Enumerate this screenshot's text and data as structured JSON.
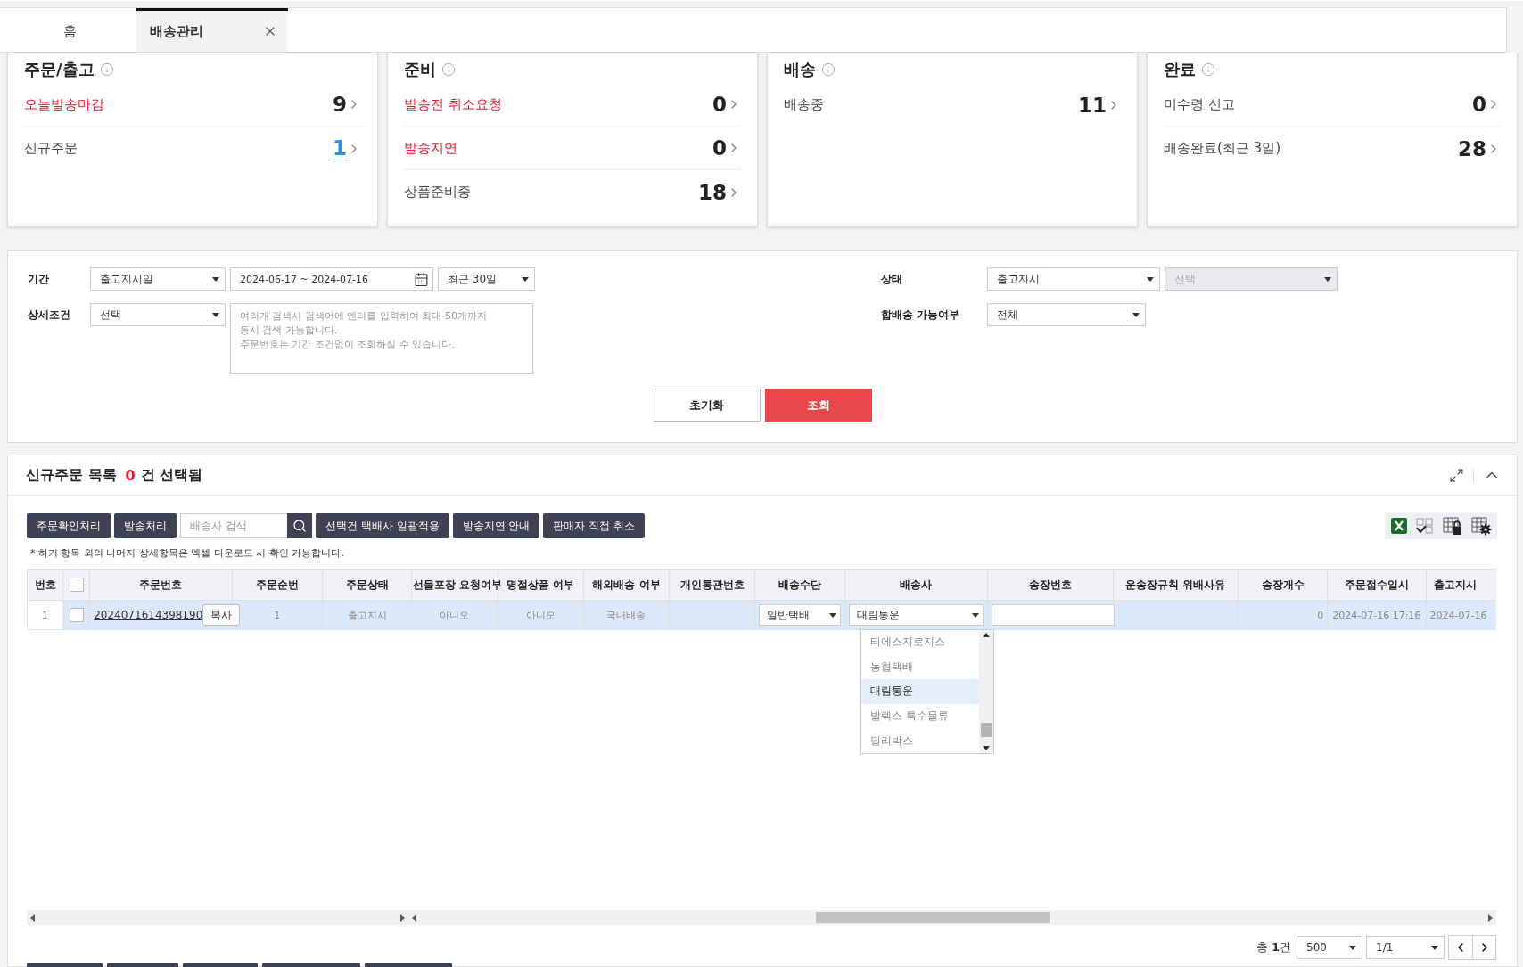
{
  "tabs": [
    {
      "label": "홈",
      "selected": false,
      "closable": false
    },
    {
      "label": "배송관리",
      "selected": true,
      "closable": true
    }
  ],
  "summary": [
    {
      "title": "주문/출고",
      "rows": [
        {
          "label": "오늘발송마감",
          "count": "9",
          "alert": true,
          "highlight": false
        },
        {
          "label": "신규주문",
          "count": "1",
          "alert": false,
          "highlight": true
        }
      ]
    },
    {
      "title": "준비",
      "rows": [
        {
          "label": "발송전 취소요청",
          "count": "0",
          "alert": true,
          "highlight": false
        },
        {
          "label": "발송지연",
          "count": "0",
          "alert": true,
          "highlight": false
        },
        {
          "label": "상품준비중",
          "count": "18",
          "alert": false,
          "highlight": false
        }
      ]
    },
    {
      "title": "배송",
      "rows": [
        {
          "label": "배송중",
          "count": "11",
          "alert": false,
          "highlight": false
        }
      ]
    },
    {
      "title": "완료",
      "rows": [
        {
          "label": "미수령 신고",
          "count": "0",
          "alert": false,
          "highlight": false
        },
        {
          "label": "배송완료(최근 3일)",
          "count": "28",
          "alert": false,
          "highlight": false
        }
      ]
    }
  ],
  "filters": {
    "left": [
      {
        "label": "기간",
        "controls": [
          {
            "kind": "select",
            "value": "출고지시일",
            "disabled": false
          },
          {
            "kind": "date",
            "value": "2024-06-17 ~ 2024-07-16"
          },
          {
            "kind": "select",
            "value": "최근 30일",
            "disabled": false
          }
        ]
      },
      {
        "label": "상세조건",
        "controls": [
          {
            "kind": "select",
            "value": "선택",
            "disabled": false
          },
          {
            "kind": "textarea",
            "placeholder": "여러개 검색시 검색어에 엔터를 입력하여 최대 50개까지\n동시 검색 가능합니다.\n주문번호는 기간 조건없이 조회하실 수 있습니다."
          }
        ]
      }
    ],
    "right": [
      {
        "label": "상태",
        "controls": [
          {
            "kind": "select",
            "value": "출고지시",
            "disabled": false
          },
          {
            "kind": "select",
            "value": "선택",
            "disabled": true
          }
        ]
      },
      {
        "label": "합배송 가능여부",
        "controls": [
          {
            "kind": "select",
            "value": "전체",
            "disabled": false
          }
        ]
      }
    ]
  },
  "filter_buttons": [
    {
      "label": "초기화",
      "kind": "secondary"
    },
    {
      "label": "조회",
      "kind": "primary"
    }
  ],
  "list": {
    "title": "신규주문 목록",
    "selected_count": "0",
    "selected_suffix": "건 선택됨",
    "actions": [
      {
        "kind": "button",
        "label": "주문확인처리"
      },
      {
        "kind": "button",
        "label": "발송처리"
      },
      {
        "kind": "search",
        "placeholder": "배송사 검색"
      },
      {
        "kind": "button",
        "label": "선택건 택배사 일괄적용"
      },
      {
        "kind": "button",
        "label": "발송지연 안내"
      },
      {
        "kind": "button",
        "label": "판매자 직접 취소"
      }
    ],
    "note": "* 하기 항목 외의 나머지 상세항목은 엑셀 다운로드 시 확인 가능합니다.",
    "columns": [
      "번호",
      "",
      "주문번호",
      "주문순번",
      "주문상태",
      "선물포장 요청여부",
      "명절상품 여부",
      "해외배송 여부",
      "개인통관번호",
      "배송수단",
      "배송사",
      "송장번호",
      "운송장규칙 위배사유",
      "송장개수",
      "주문접수일시",
      "출고지시"
    ],
    "header_checked": false,
    "rows": [
      {
        "no": "1",
        "checked": false,
        "selected": true,
        "order_no": "2024071614398190",
        "copy": "복사",
        "seq": "1",
        "status": "출고지시",
        "gift": "아니오",
        "holiday": "아니오",
        "overseas": "국내배송",
        "method": "일반택배",
        "carrier": "대림통운",
        "invoice_count": "0",
        "received": "2024-07-16 17:16",
        "shipped": "2024-07-16"
      }
    ],
    "carrier_options": [
      {
        "label": "티에스지로지스",
        "selected": false
      },
      {
        "label": "농협택배",
        "selected": false
      },
      {
        "label": "대림통운",
        "selected": true
      },
      {
        "label": "발렉스 특수물류",
        "selected": false
      },
      {
        "label": "딜리박스",
        "selected": false
      }
    ],
    "pager": {
      "total": "총 **1**건",
      "page_size": "500",
      "page": "1/1"
    }
  }
}
